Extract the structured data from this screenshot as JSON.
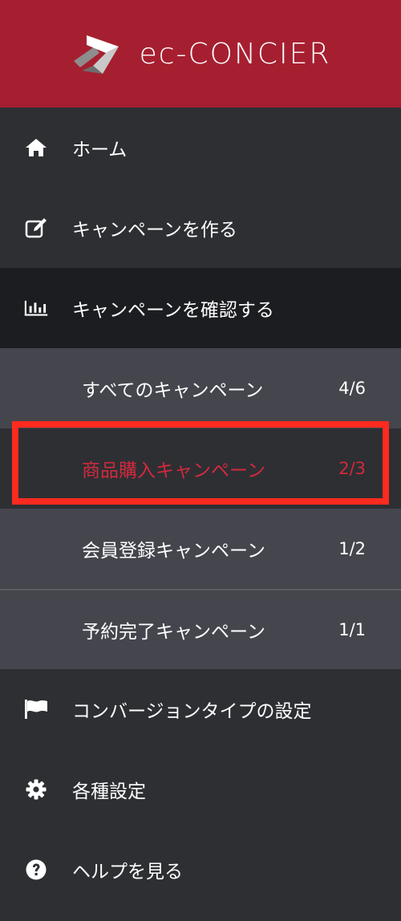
{
  "brand": {
    "name": "ec-CONCIER",
    "header_color": "#a61f30"
  },
  "nav": {
    "home": {
      "label": "ホーム",
      "icon": "home-icon"
    },
    "create_campaign": {
      "label": "キャンペーンを作る",
      "icon": "edit-icon"
    },
    "review_campaigns": {
      "label": "キャンペーンを確認する",
      "icon": "bar-chart-icon"
    },
    "conversion_settings": {
      "label": "コンバージョンタイプの設定",
      "icon": "flag-icon"
    },
    "settings": {
      "label": "各種設定",
      "icon": "gear-icon"
    },
    "help": {
      "label": "ヘルプを見る",
      "icon": "question-icon"
    }
  },
  "submenu": {
    "items": [
      {
        "label": "すべてのキャンペーン",
        "count": "4/6"
      },
      {
        "label": "商品購入キャンペーン",
        "count": "2/3"
      },
      {
        "label": "会員登録キャンペーン",
        "count": "1/2"
      },
      {
        "label": "予約完了キャンペーン",
        "count": "1/1"
      }
    ],
    "selected_color": "#d12a3e"
  },
  "highlight_color": "#ff2a1f"
}
